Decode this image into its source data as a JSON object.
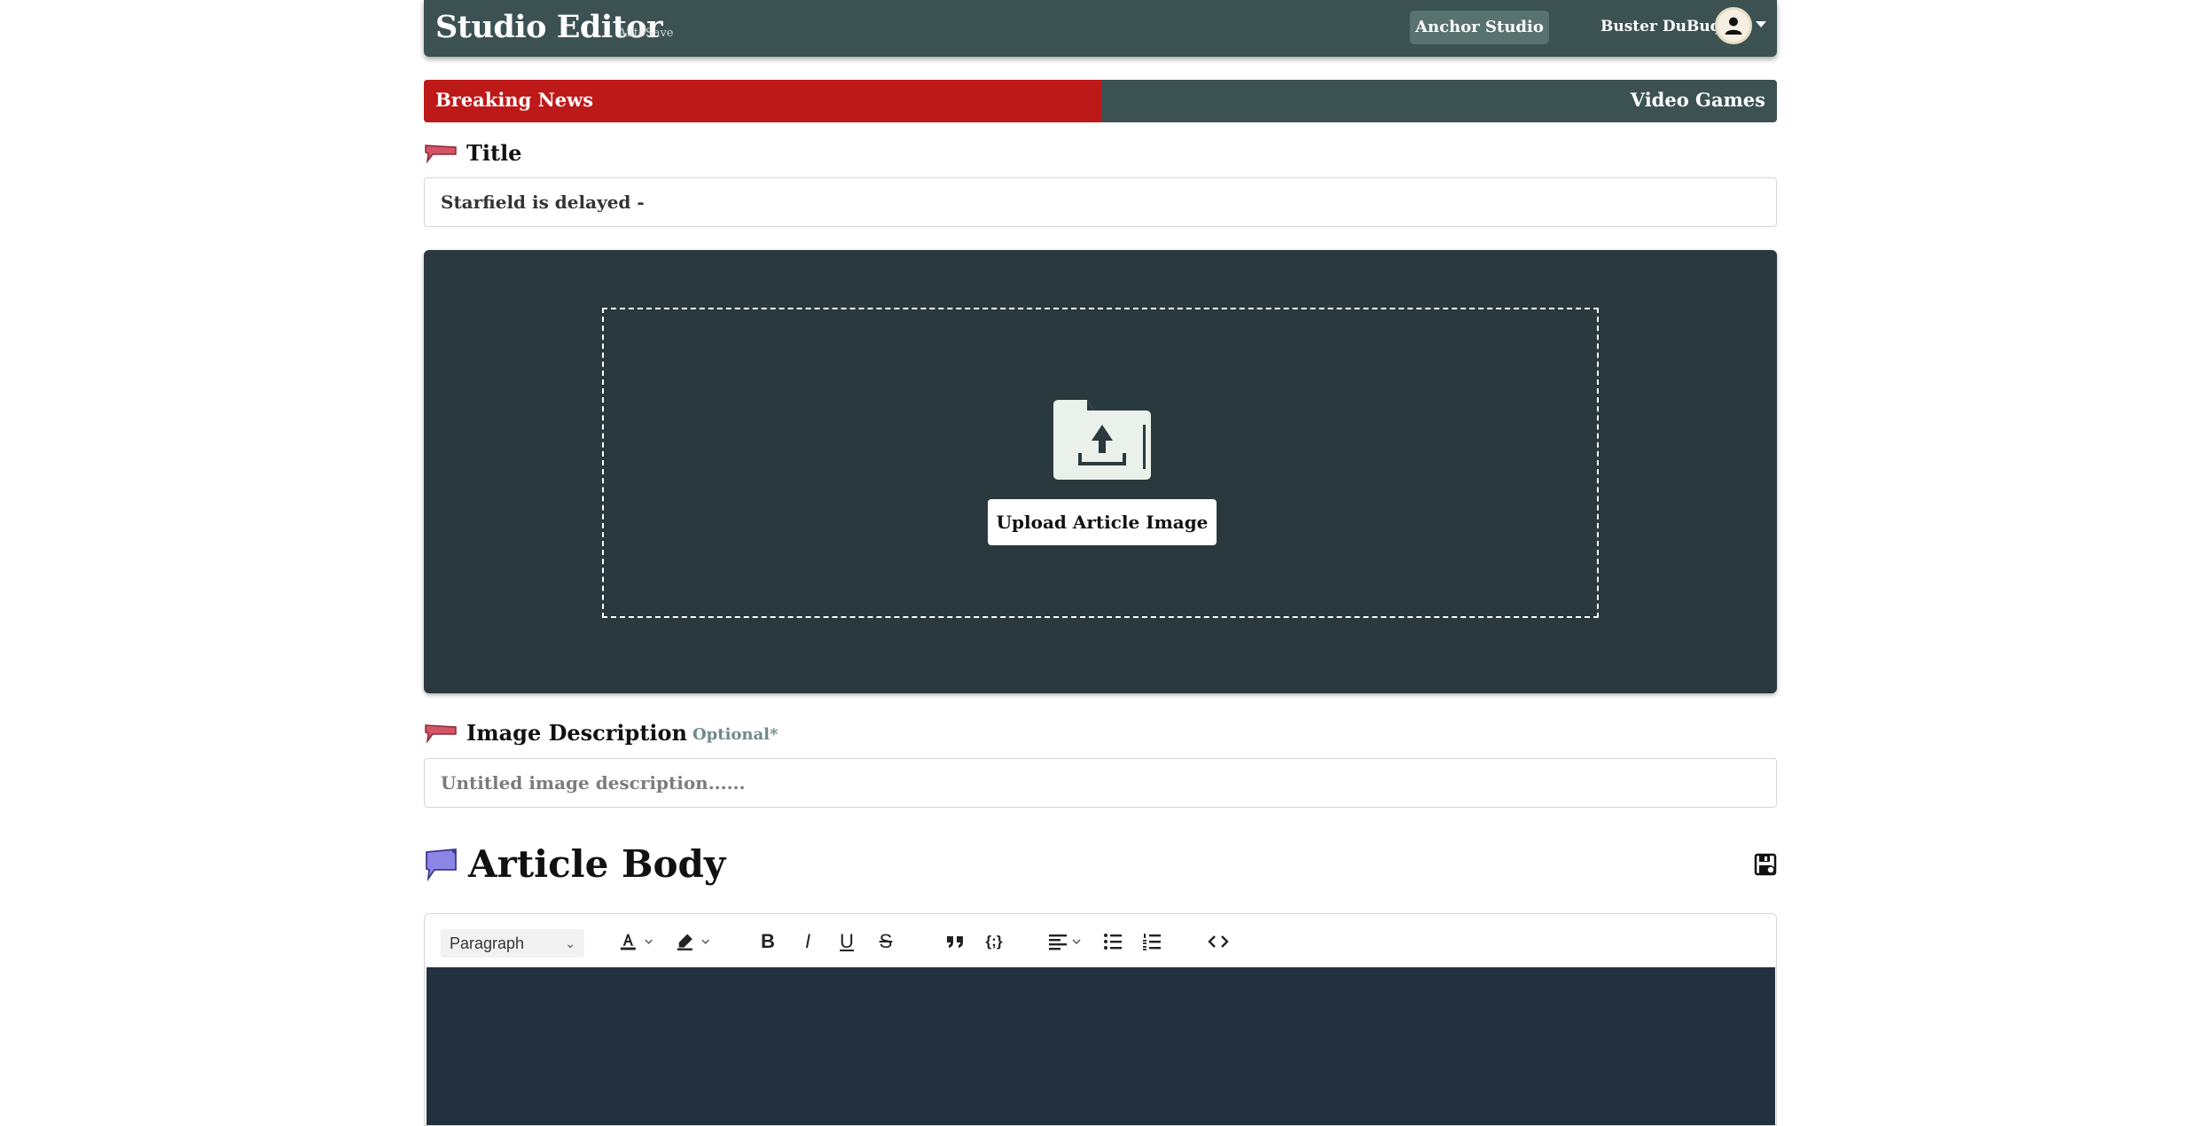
{
  "header": {
    "brand": "Studio Editor",
    "autosave": "AutoSave",
    "studio_button": "Anchor Studio",
    "username": "Buster DuBuque"
  },
  "category_bar": {
    "left": "Breaking News",
    "right": "Video Games"
  },
  "title_section": {
    "label": "Title",
    "value": "Starfield is delayed -"
  },
  "upload": {
    "button": "Upload Article Image"
  },
  "image_description": {
    "label": "Image Description",
    "optional": "Optional*",
    "placeholder": "Untitled image description......"
  },
  "article_body": {
    "label": "Article Body"
  },
  "toolbar": {
    "block_type": "Paragraph",
    "icons": [
      "font-color-icon",
      "highlight-icon",
      "bold-icon",
      "italic-icon",
      "underline-icon",
      "strikethrough-icon",
      "blockquote-icon",
      "code-block-icon",
      "align-icon",
      "bulleted-list-icon",
      "numbered-list-icon",
      "source-code-icon"
    ]
  },
  "colors": {
    "header": "#3b5152",
    "breaking": "#bd1919",
    "upload_panel": "#29393e",
    "editor_area": "#233040"
  }
}
